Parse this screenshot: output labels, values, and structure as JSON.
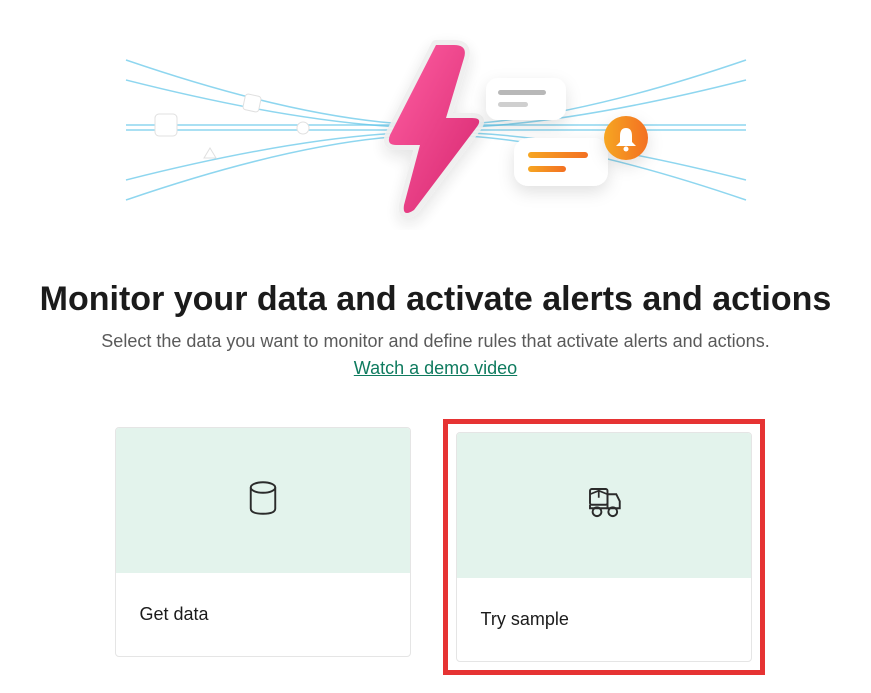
{
  "heading": "Monitor your data and activate alerts and actions",
  "subtext": "Select the data you want to monitor and define rules that activate alerts and actions.",
  "demo_link": "Watch a demo video",
  "cards": {
    "get_data": {
      "label": "Get data"
    },
    "try_sample": {
      "label": "Try sample"
    }
  },
  "colors": {
    "accent_pink": "#e83e8c",
    "accent_orange": "#f39c12",
    "accent_teal": "#0f7b5f",
    "card_bg": "#e3f3ec",
    "highlight": "#e63333"
  }
}
